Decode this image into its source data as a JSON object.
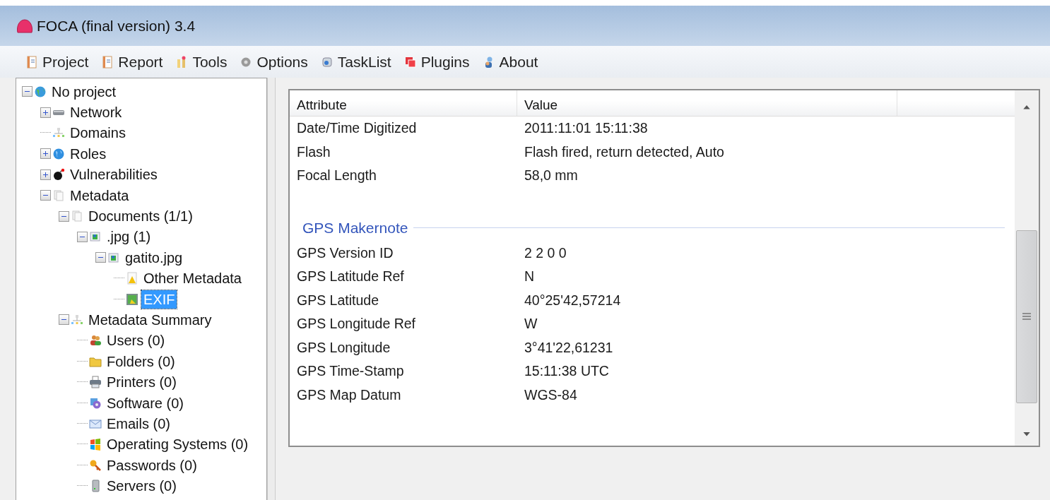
{
  "window": {
    "title": "FOCA (final version) 3.4"
  },
  "menu": [
    {
      "label": "Project"
    },
    {
      "label": "Report"
    },
    {
      "label": "Tools"
    },
    {
      "label": "Options"
    },
    {
      "label": "TaskList"
    },
    {
      "label": "Plugins"
    },
    {
      "label": "About"
    }
  ],
  "tree": [
    {
      "label": "No project",
      "expanded": true,
      "selected": false,
      "children": [
        {
          "label": "Network",
          "expanded": false,
          "selected": false
        },
        {
          "label": "Domains",
          "selected": false
        },
        {
          "label": "Roles",
          "expanded": false,
          "selected": false
        },
        {
          "label": "Vulnerabilities",
          "expanded": false,
          "selected": false
        },
        {
          "label": "Metadata",
          "expanded": true,
          "selected": false,
          "children": [
            {
              "label": "Documents (1/1)",
              "expanded": true,
              "selected": false,
              "children": [
                {
                  "label": ".jpg (1)",
                  "expanded": true,
                  "selected": false,
                  "children": [
                    {
                      "label": "gatito.jpg",
                      "expanded": true,
                      "selected": false,
                      "children": [
                        {
                          "label": "Other Metadata",
                          "selected": false
                        },
                        {
                          "label": "EXIF",
                          "selected": true
                        }
                      ]
                    }
                  ]
                }
              ]
            },
            {
              "label": "Metadata Summary",
              "expanded": true,
              "selected": false,
              "children": [
                {
                  "label": "Users (0)",
                  "selected": false
                },
                {
                  "label": "Folders (0)",
                  "selected": false
                },
                {
                  "label": "Printers (0)",
                  "selected": false
                },
                {
                  "label": "Software (0)",
                  "selected": false
                },
                {
                  "label": "Emails (0)",
                  "selected": false
                },
                {
                  "label": "Operating Systems (0)",
                  "selected": false
                },
                {
                  "label": "Passwords (0)",
                  "selected": false
                },
                {
                  "label": "Servers (0)",
                  "selected": false
                }
              ]
            }
          ]
        }
      ]
    }
  ],
  "table": {
    "columns": [
      "Attribute",
      "Value"
    ],
    "rows": [
      {
        "kind": "row",
        "attribute": "Date/Time Digitized",
        "value": "2011:11:01 15:11:38"
      },
      {
        "kind": "row",
        "attribute": "Flash",
        "value": "Flash fired, return detected, Auto"
      },
      {
        "kind": "row",
        "attribute": "Focal Length",
        "value": "58,0 mm"
      },
      {
        "kind": "group",
        "title": "GPS Makernote"
      },
      {
        "kind": "row",
        "attribute": "GPS Version ID",
        "value": "2 2 0 0"
      },
      {
        "kind": "row",
        "attribute": "GPS Latitude Ref",
        "value": "N"
      },
      {
        "kind": "row",
        "attribute": "GPS Latitude",
        "value": "40°25'42,57214"
      },
      {
        "kind": "row",
        "attribute": "GPS Longitude Ref",
        "value": "W"
      },
      {
        "kind": "row",
        "attribute": "GPS Longitude",
        "value": "3°41'22,61231"
      },
      {
        "kind": "row",
        "attribute": "GPS Time-Stamp",
        "value": "15:11:38 UTC"
      },
      {
        "kind": "row",
        "attribute": "GPS Map Datum",
        "value": "WGS-84"
      }
    ]
  }
}
